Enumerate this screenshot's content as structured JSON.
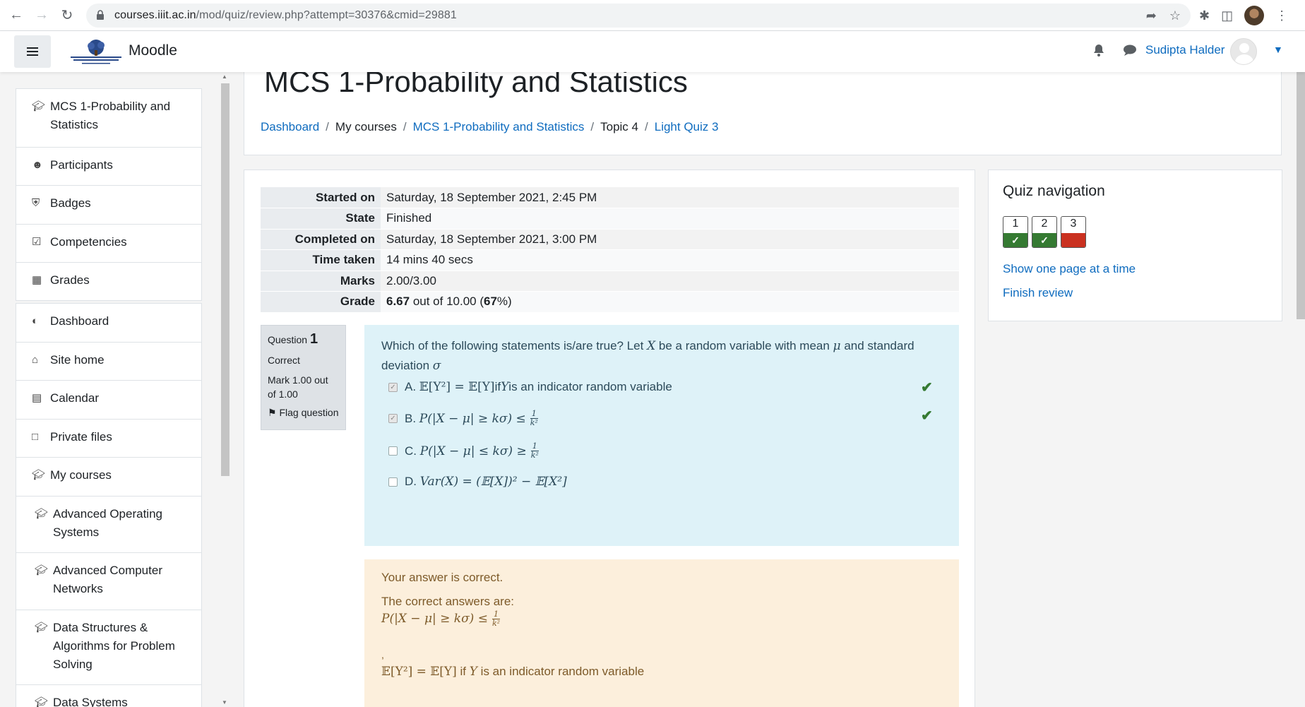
{
  "browser": {
    "url_host": "courses.iiit.ac.in",
    "url_path": "/mod/quiz/review.php?attempt=30376&cmid=29881"
  },
  "navbar": {
    "brand": "Moodle",
    "user_name": "Sudipta Halder"
  },
  "sidebar": {
    "course_items": [
      {
        "icon": "graduation-cap-icon",
        "label": "MCS 1-Probability and Statistics"
      },
      {
        "icon": "users-icon",
        "label": "Participants"
      },
      {
        "icon": "shield-icon",
        "label": "Badges"
      },
      {
        "icon": "check-square-icon",
        "label": "Competencies"
      },
      {
        "icon": "table-icon",
        "label": "Grades"
      }
    ],
    "site_items": [
      {
        "icon": "dashboard-icon",
        "label": "Dashboard"
      },
      {
        "icon": "home-icon",
        "label": "Site home"
      },
      {
        "icon": "calendar-icon",
        "label": "Calendar"
      },
      {
        "icon": "file-icon",
        "label": "Private files"
      },
      {
        "icon": "graduation-cap-icon",
        "label": "My courses"
      },
      {
        "icon": "graduation-cap-icon",
        "label": "Advanced Operating Systems"
      },
      {
        "icon": "graduation-cap-icon",
        "label": "Advanced Computer Networks"
      },
      {
        "icon": "graduation-cap-icon",
        "label": "Data Structures & Algorithms for Problem Solving"
      },
      {
        "icon": "graduation-cap-icon",
        "label": "Data Systems"
      }
    ]
  },
  "header": {
    "course_title": "MCS 1-Probability and Statistics",
    "breadcrumb": [
      "Dashboard",
      "My courses",
      "MCS 1-Probability and Statistics",
      "Topic 4",
      "Light Quiz 3"
    ]
  },
  "summary": [
    {
      "label": "Started on",
      "value": "Saturday, 18 September 2021, 2:45 PM"
    },
    {
      "label": "State",
      "value": "Finished"
    },
    {
      "label": "Completed on",
      "value": "Saturday, 18 September 2021, 3:00 PM"
    },
    {
      "label": "Time taken",
      "value": "14 mins 40 secs"
    },
    {
      "label": "Marks",
      "value": "2.00/3.00"
    },
    {
      "label": "Grade",
      "value_bold": "6.67",
      "value_mid": " out of 10.00 (",
      "value_pct": "67",
      "value_end": "%)"
    }
  ],
  "question": {
    "label": "Question",
    "number": "1",
    "status": "Correct",
    "mark": "Mark 1.00 out of 1.00",
    "flag": "Flag question",
    "text_a": "Which of the following statements is/are true? Let ",
    "var_x": "X",
    "text_b": " be a random variable with mean ",
    "var_mu": "μ",
    "text_c": " and standard deviation ",
    "var_sigma": "σ",
    "options": [
      {
        "letter": "A.",
        "math": "𝔼[Y²] = 𝔼[Y]",
        "suffix_a": " if ",
        "var": "Y",
        "suffix_b": " is an indicator random variable",
        "checked": true,
        "correct": true
      },
      {
        "letter": "B.",
        "math": "P(|X − μ| ≥ kσ) ≤",
        "frac_num": "1",
        "frac_den": "k²",
        "checked": true,
        "correct": true
      },
      {
        "letter": "C.",
        "math": "P(|X − μ| ≤ kσ) ≥",
        "frac_num": "1",
        "frac_den": "k²",
        "checked": false,
        "correct": false
      },
      {
        "letter": "D.",
        "math": "Var(X) = (𝔼[X])² − 𝔼[X²]",
        "checked": false,
        "correct": false
      }
    ]
  },
  "feedback": {
    "result": "Your answer is correct.",
    "correct_heading": "The correct answers are:",
    "correct_1_math": "P(|X − μ| ≥ kσ) ≤",
    "correct_1_num": "1",
    "correct_1_den": "k²",
    "separator": ",",
    "correct_2_math": "𝔼[Y²] = 𝔼[Y]",
    "correct_2_a": " if ",
    "correct_2_var": "Y",
    "correct_2_b": " is an indicator random variable"
  },
  "quiz_nav": {
    "title": "Quiz navigation",
    "questions": [
      {
        "number": "1",
        "state": "correct"
      },
      {
        "number": "2",
        "state": "correct"
      },
      {
        "number": "3",
        "state": "incorrect"
      }
    ],
    "show_one_page": "Show one page at a time",
    "finish_review": "Finish review"
  },
  "colors": {
    "link": "#0f6cbf",
    "correct": "#357a32",
    "incorrect": "#ca3120",
    "question_bg": "#def2f8",
    "feedback_bg": "#fcefdc"
  }
}
